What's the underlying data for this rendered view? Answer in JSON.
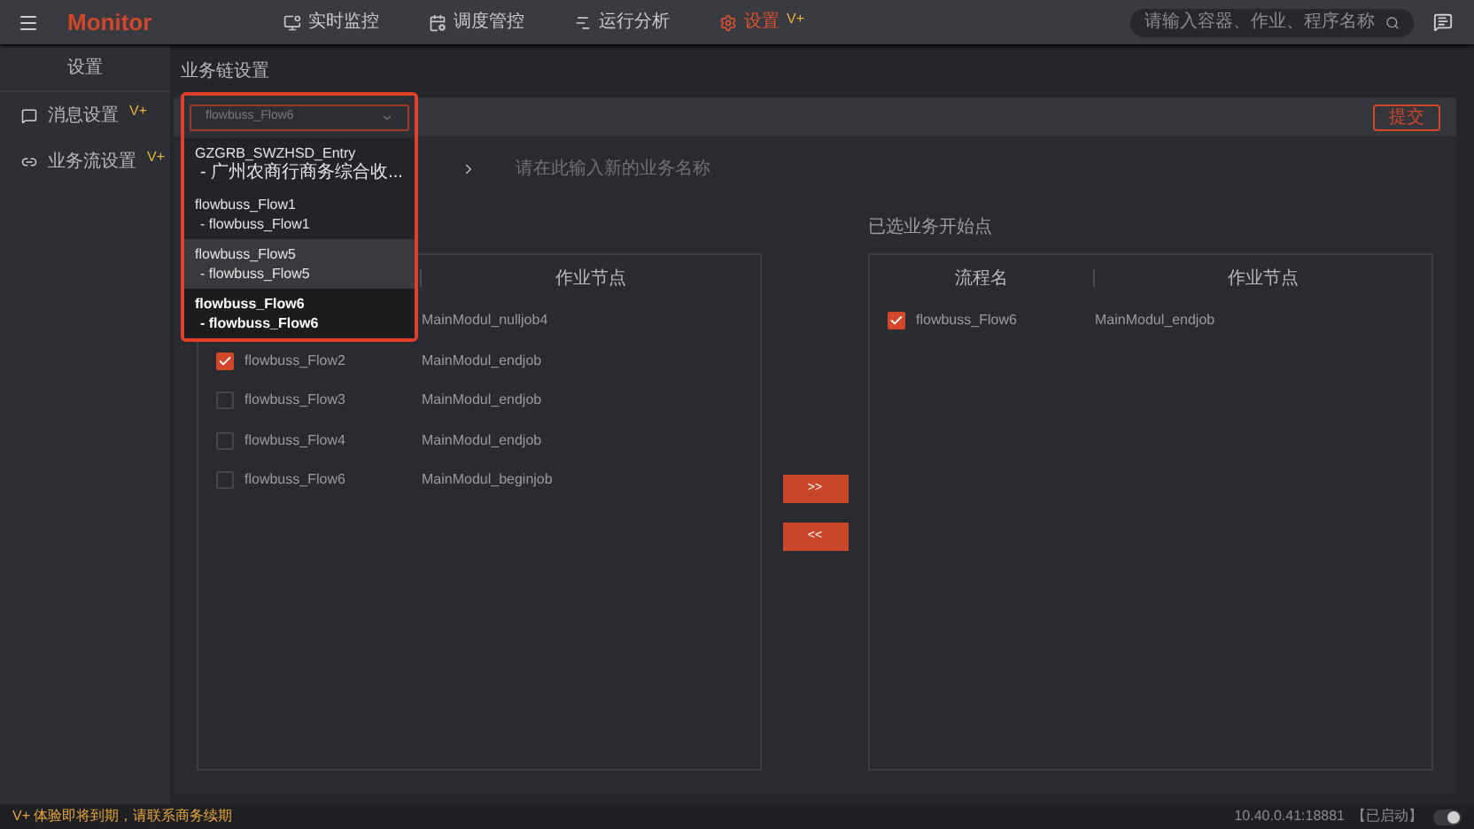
{
  "topbar": {
    "logo": "Monitor",
    "nav": [
      {
        "label": "实时监控",
        "selected": false
      },
      {
        "label": "调度管控",
        "selected": false
      },
      {
        "label": "运行分析",
        "selected": false
      },
      {
        "label": "设置",
        "badge": "V+",
        "selected": true
      }
    ],
    "search": {
      "placeholder": "请输入容器、作业、程序名称"
    }
  },
  "sidebar": {
    "title": "设置",
    "items": [
      {
        "label": "消息设置",
        "badge": "V+",
        "selected": false
      },
      {
        "label": "业务流设置",
        "badge": "V+",
        "selected": false
      }
    ]
  },
  "page_title": "业务链设置",
  "submit_button": "提交",
  "dropdown": {
    "value": "flowbuss_Flow6",
    "options": [
      {
        "line1": "GZGRB_SWZHSD_Entry",
        "line2": "- 广州农商行商务综合收...",
        "selected": false,
        "hovered": false
      },
      {
        "line1": "flowbuss_Flow1",
        "line2": "- flowbuss_Flow1",
        "selected": false,
        "hovered": false
      },
      {
        "line1": "flowbuss_Flow5",
        "line2": "- flowbuss_Flow5",
        "selected": false,
        "hovered": true
      },
      {
        "line1": "flowbuss_Flow6",
        "line2": "- flowbuss_Flow6",
        "selected": true,
        "hovered": false
      }
    ]
  },
  "name_field": {
    "placeholder": "请在此输入新的业务名称"
  },
  "left_table": {
    "columns": [
      "作业节点"
    ],
    "rows": [
      {
        "node": "MainModul_nulljob4"
      },
      {
        "name": "flowbuss_Flow2",
        "node": "MainModul_endjob",
        "checked": true
      },
      {
        "name": "flowbuss_Flow3",
        "node": "MainModul_endjob",
        "checked": false
      },
      {
        "name": "flowbuss_Flow4",
        "node": "MainModul_endjob",
        "checked": false
      },
      {
        "name": "flowbuss_Flow6",
        "node": "MainModul_beginjob",
        "checked": false
      }
    ]
  },
  "move_buttons": [
    ">>",
    "<<"
  ],
  "right_table": {
    "label": "已选业务开始点",
    "columns": [
      "流程名",
      "作业节点"
    ],
    "rows": [
      {
        "name": "flowbuss_Flow6",
        "node": "MainModul_endjob",
        "checked": true
      }
    ]
  },
  "status_bar": {
    "notice": "V+ 体验即将到期，请联系商务续期",
    "address": "10.40.0.41:18881",
    "state": "【已启动】"
  }
}
